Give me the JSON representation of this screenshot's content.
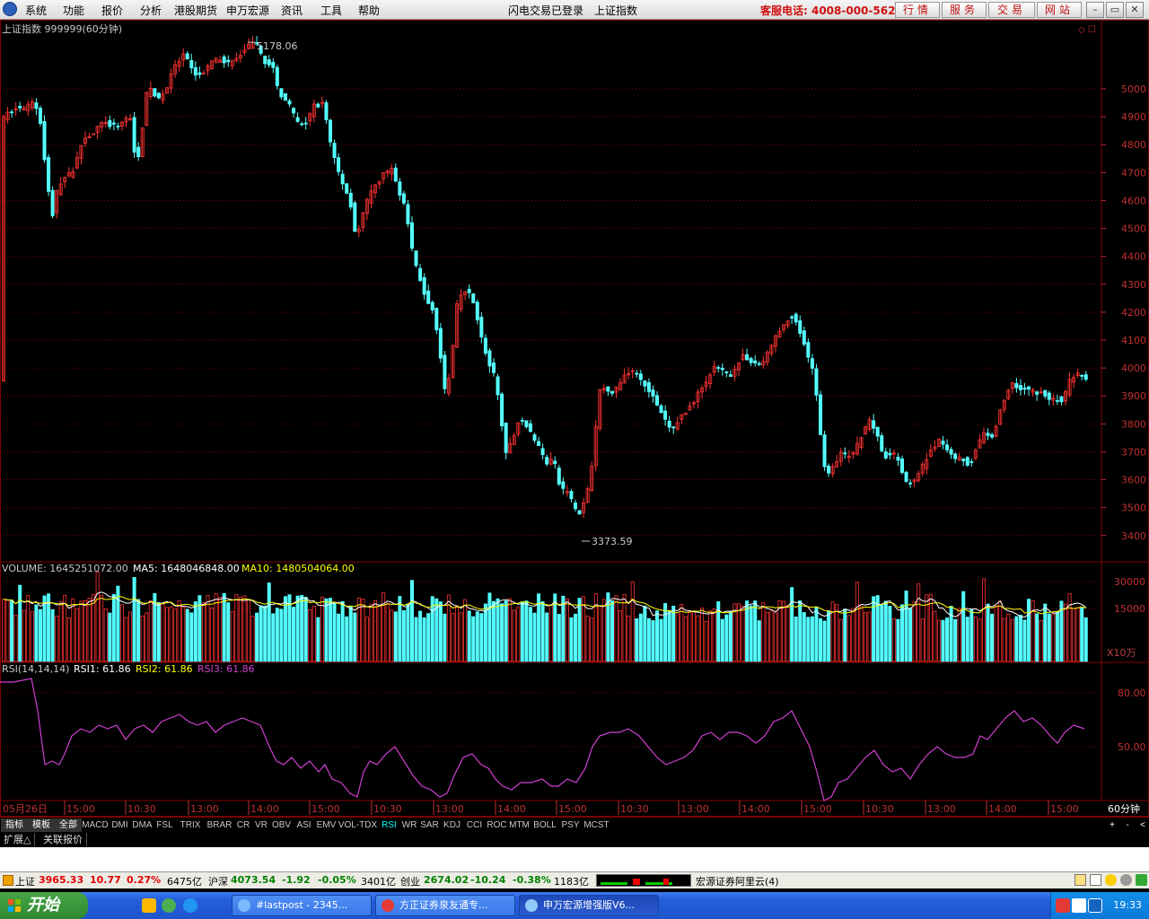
{
  "menu": [
    "系统",
    "功能",
    "报价",
    "分析",
    "港股期货",
    "申万宏源",
    "资讯",
    "工具",
    "帮助"
  ],
  "title": {
    "login": "闪电交易已登录",
    "index": "上证指数"
  },
  "hotline": "客服电话: 4008-000-562",
  "top_buttons": [
    "行情",
    "服务",
    "交易",
    "网站"
  ],
  "window_controls": [
    "–",
    "▭",
    "✕"
  ],
  "main_chart": {
    "header": "上证指数 999999(60分钟)",
    "high_label": "5178.06",
    "low_label": "3373.59",
    "yticks": [
      "5000",
      "4900",
      "4800",
      "4700",
      "4600",
      "4500",
      "4400",
      "4300",
      "4200",
      "4100",
      "4000",
      "3900",
      "3800",
      "3700",
      "3600",
      "3500",
      "3400"
    ],
    "corner_icons": "◇ ☐"
  },
  "volume": {
    "label": "VOLUME: 1645251072.00",
    "ma5": "MA5: 1648046848.00",
    "ma10": "MA10: 1480504064.00",
    "yticks": [
      "30000",
      "15000"
    ],
    "unit": "X10万"
  },
  "rsi": {
    "label": "RSI(14,14,14)",
    "rsi1": "RSI1: 61.86",
    "rsi2": "RSI2: 61.86",
    "rsi3": "RSI3: 61.86",
    "yticks": [
      "80.00",
      "50.00"
    ]
  },
  "xaxis": {
    "labels": [
      "05月26日",
      "15:00",
      "10:30",
      "13:00",
      "14:00",
      "15:00",
      "10:30",
      "13:00",
      "14:00",
      "15:00",
      "10:30",
      "13:00",
      "14:00",
      "15:00",
      "10:30",
      "13:00",
      "14:00",
      "15:00"
    ],
    "period": "60分钟"
  },
  "indicators": [
    "指标",
    "模板",
    "全部",
    "MACD",
    "DMI",
    "DMA",
    "FSL",
    "TRIX",
    "BRAR",
    "CR",
    "VR",
    "OBV",
    "ASI",
    "EMV",
    "VOL-TDX",
    "RSI",
    "WR",
    "SAR",
    "KDJ",
    "CCI",
    "ROC",
    "MTM",
    "BOLL",
    "PSY",
    "MCST"
  ],
  "active_indicator": "RSI",
  "indicator_controls": [
    "+",
    "-",
    "<"
  ],
  "subtabs": [
    "扩展△",
    "关联报价"
  ],
  "status": {
    "sh_name": "上证",
    "sh_val": "3965.33",
    "sh_chg": "10.77",
    "sh_pct": "0.27%",
    "sh_amt": "6475亿",
    "hs_name": "沪深",
    "hs_val": "4073.54",
    "hs_chg": "-1.92",
    "hs_pct": "-0.05%",
    "hs_amt": "3401亿",
    "cy_name": "创业",
    "cy_val": "2674.02",
    "cy_chg": "-10.24",
    "cy_pct": "-0.38%",
    "cy_amt": "1183亿",
    "server": "宏源证券阿里云(4)"
  },
  "taskbar": {
    "start": "开始",
    "tasks": [
      "#lastpost - 2345...",
      "方正证券泉友通专...",
      "申万宏源增强版V6..."
    ],
    "clock": "19:33"
  },
  "colors": {
    "up": "#ff3232",
    "down": "#54ffff",
    "grid": "#800000",
    "rsi": "#d040d0",
    "ma5": "#ffffff",
    "ma10": "#ffff00"
  }
}
